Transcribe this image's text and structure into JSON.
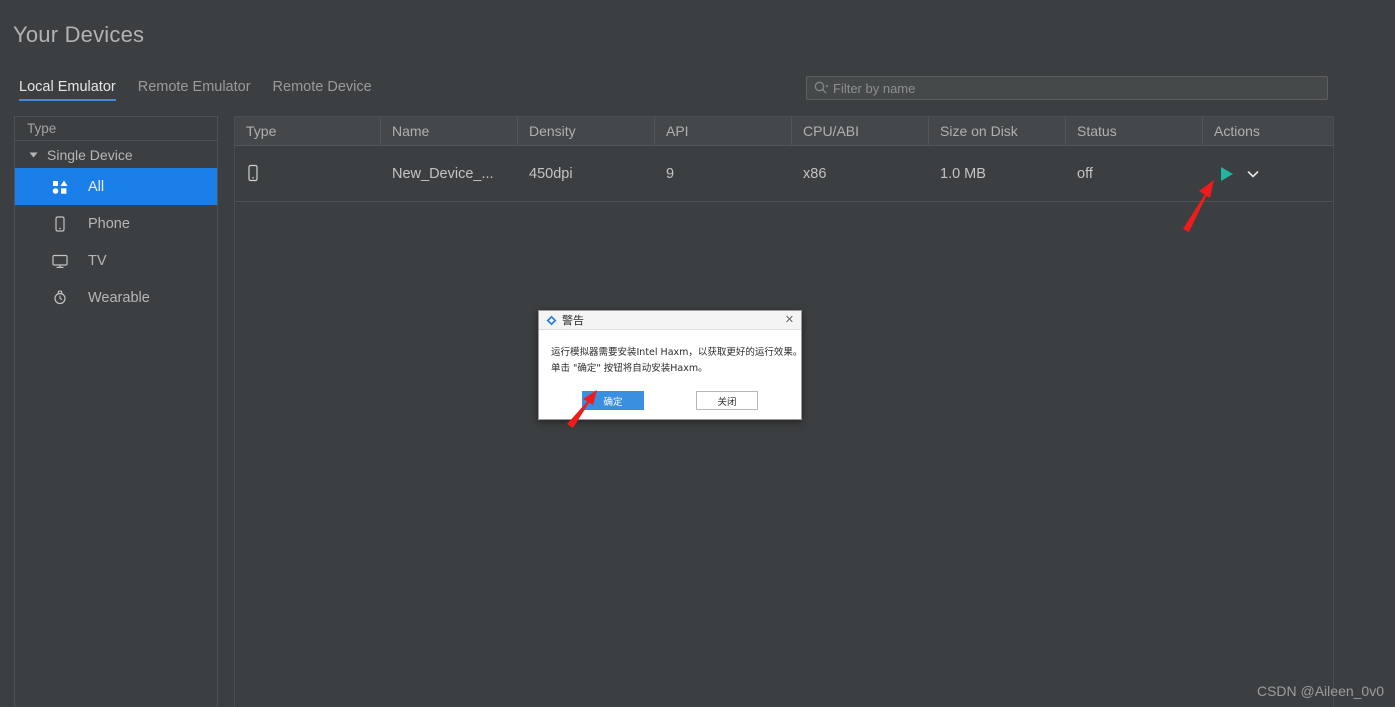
{
  "page": {
    "title": "Your Devices",
    "watermark": "CSDN @Aileen_0v0"
  },
  "tabs": [
    {
      "label": "Local Emulator",
      "active": true
    },
    {
      "label": "Remote Emulator",
      "active": false
    },
    {
      "label": "Remote Device",
      "active": false
    }
  ],
  "search": {
    "placeholder": "Filter by name",
    "value": "",
    "icon": "search-icon"
  },
  "sidebar": {
    "header": "Type",
    "group": {
      "label": "Single Device",
      "expanded": true
    },
    "items": [
      {
        "label": "All",
        "icon": "all-shapes-icon",
        "selected": true
      },
      {
        "label": "Phone",
        "icon": "phone-icon",
        "selected": false
      },
      {
        "label": "TV",
        "icon": "tv-icon",
        "selected": false
      },
      {
        "label": "Wearable",
        "icon": "watch-icon",
        "selected": false
      }
    ],
    "selection_color": "#1a7fe8"
  },
  "table": {
    "columns": [
      "Type",
      "Name",
      "Density",
      "API",
      "CPU/ABI",
      "Size on Disk",
      "Status",
      "Actions"
    ],
    "rows": [
      {
        "type_icon": "phone-icon",
        "name": "New_Device_...",
        "density": "450dpi",
        "api": "9",
        "cpu_abi": "x86",
        "size_on_disk": "1.0 MB",
        "status": "off",
        "actions": {
          "run": "run-play-icon",
          "more": "chevron-down-icon"
        }
      }
    ],
    "link_color": "#5b9fe0",
    "run_icon_color": "#24b5a0"
  },
  "dialog": {
    "title": "警告",
    "icon": "diamond-warning-icon",
    "close_icon": "close-icon",
    "lines": [
      "运行模拟器需要安装Intel Haxm，以获取更好的运行效果。",
      "单击 \"确定\" 按钮将自动安装Haxm。"
    ],
    "ok_label": "确定",
    "close_label": "关闭",
    "ok_color": "#3a8fe0"
  },
  "annotations": {
    "arrow_color": "#f01c1c",
    "arrows": [
      {
        "name": "arrow-to-run-button"
      },
      {
        "name": "arrow-to-ok-button"
      }
    ]
  }
}
